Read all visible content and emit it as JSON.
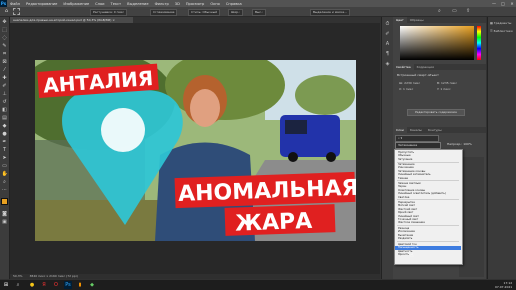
{
  "menubar": {
    "logo": "Ps",
    "items": [
      "Файл",
      "Редактирование",
      "Изображение",
      "Слои",
      "Текст",
      "Выделение",
      "Фильтр",
      "3D",
      "Просмотр",
      "Окно",
      "Справка"
    ],
    "win_min": "—",
    "win_max": "□",
    "win_close": "✕"
  },
  "optionsbar": {
    "fields": [
      "Растушевка: 0 пикс",
      "Сглаживание",
      "Стиль: Обычный",
      "Шир.:",
      "Выс.:",
      "Выделение и маска..."
    ]
  },
  "document": {
    "tab_title": "анапелии-для-превью-на-второй-канал.psd @ 50,3% (RGB/8#) ×"
  },
  "statusbar": {
    "zoom": "50,3%",
    "info": "3840 пикс x 2160 пикс (72 ppi)"
  },
  "thumbnail": {
    "title_top": "АНТАЛИЯ",
    "line1": "АНОМАЛЬНАЯ",
    "line2": "ЖАРА"
  },
  "panels": {
    "top_tabs": [
      "Цвет",
      "Образцы"
    ],
    "right_strip": [
      "Градиенты",
      "Библиотеки"
    ],
    "properties_tabs": [
      "Свойства",
      "Коррекция"
    ],
    "properties_title": "Встроенный смарт-объект",
    "properties_fields": [
      "Ш: 2230 пикс",
      "В: 1235 пикс",
      "X: 1 пикс",
      "Y: 1 пикс"
    ],
    "properties_button": "Редактировать содержимое",
    "layers_tabs": [
      "Слои",
      "Каналы",
      "Контуры"
    ],
    "layers_mode": "Затемнение",
    "opacity_label": "Непрозр.: 100%"
  },
  "blend_menu": {
    "groups": [
      [
        "Пропустить",
        "Обычные",
        "Затухание"
      ],
      [
        "Затемнение",
        "Умножение",
        "Затемнение основы",
        "Линейный затемнитель",
        "Темнее"
      ],
      [
        "Замена светлым",
        "Экран",
        "Осветление основы",
        "Линейный осветлитель (добавить)",
        "Светлее"
      ],
      [
        "Перекрытие",
        "Мягкий свет",
        "Жесткий свет",
        "Яркий свет",
        "Линейный свет",
        "Точечный свет",
        "Жесткое смешение"
      ],
      [
        "Разница",
        "Исключение",
        "Вычитание",
        "Разделить"
      ],
      [
        "Цветовой тон",
        "Насыщенность",
        "Цветность",
        "Яркость"
      ]
    ],
    "highlighted": "Насыщенность"
  },
  "taskbar": {
    "time": "17:12",
    "date": "07.07.2021"
  }
}
